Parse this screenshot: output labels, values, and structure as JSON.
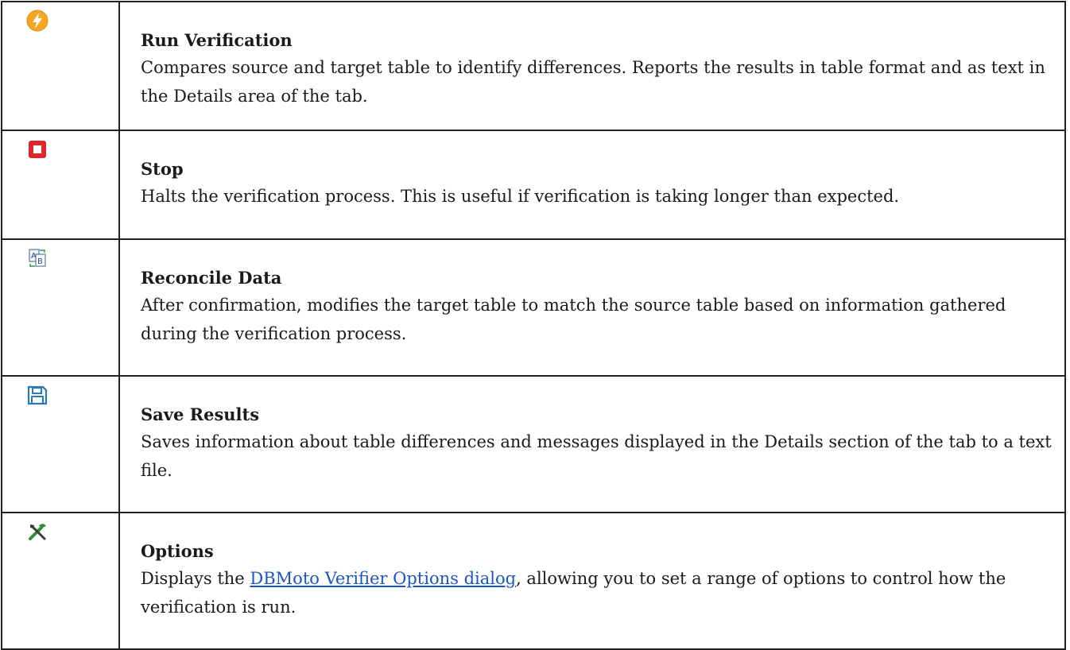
{
  "rows": [
    {
      "icon": "lightning-icon",
      "title": "Run Verification",
      "description": "Compares source and target table to identify differences. Reports the results in table format and as text in the Details area of the tab."
    },
    {
      "icon": "stop-icon",
      "title": "Stop",
      "description": "Halts the verification process. This is useful if verification is taking longer than expected."
    },
    {
      "icon": "reconcile-data-icon",
      "title": "Reconcile Data",
      "description": "After confirmation, modifies the target table to match the source table based on information gathered during the verification process."
    },
    {
      "icon": "save-icon",
      "title": "Save Results",
      "description": "Saves information about table differences and messages displayed in the Details section of the tab to a text file."
    },
    {
      "icon": "tools-icon",
      "title": "Options",
      "description_before": "Displays the ",
      "link_text": "DBMoto Verifier Options dialog",
      "description_after": ", allowing you to set a range of options to control how the verification is run."
    }
  ],
  "colors": {
    "run_icon": "#f5a623",
    "stop_icon": "#e0252d",
    "save_icon": "#2a7ab8",
    "tools_icon": "#2f8f3b",
    "link": "#1a55c4",
    "border": "#222222"
  }
}
